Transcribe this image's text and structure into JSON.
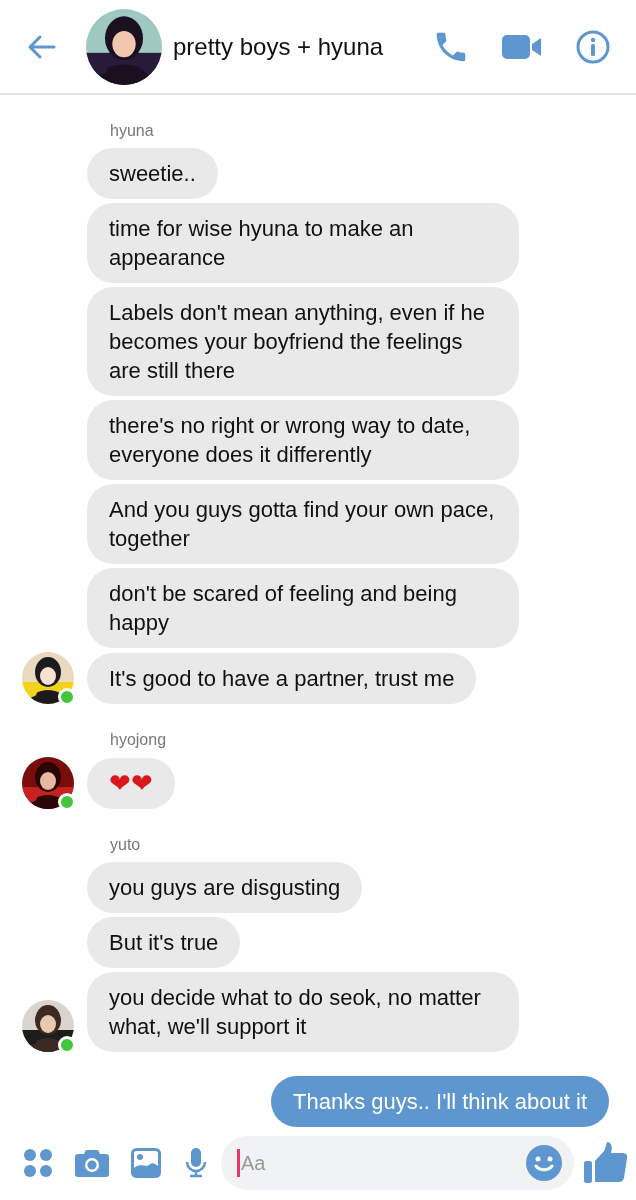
{
  "header": {
    "title": "pretty boys + hyuna"
  },
  "groups": [
    {
      "sender": "hyuna",
      "online": true,
      "messages": [
        "sweetie..",
        "time for wise hyuna to make an appearance",
        "Labels don't mean anything, even if he becomes your boyfriend the feelings are still there",
        "there's no right or wrong way to date, everyone does it differently",
        "And you guys gotta find your own pace, together",
        "don't be scared of feeling and being happy",
        "It's good to have a partner, trust me"
      ]
    },
    {
      "sender": "hyojong",
      "online": true,
      "messages": [
        "❤❤"
      ]
    },
    {
      "sender": "yuto",
      "online": true,
      "messages": [
        "you guys are disgusting",
        "But it's true",
        "you decide what to do seok, no matter what, we'll support it"
      ]
    }
  ],
  "outgoing": [
    "Thanks guys.. I'll think about it"
  ],
  "composer": {
    "placeholder": "Aa"
  }
}
